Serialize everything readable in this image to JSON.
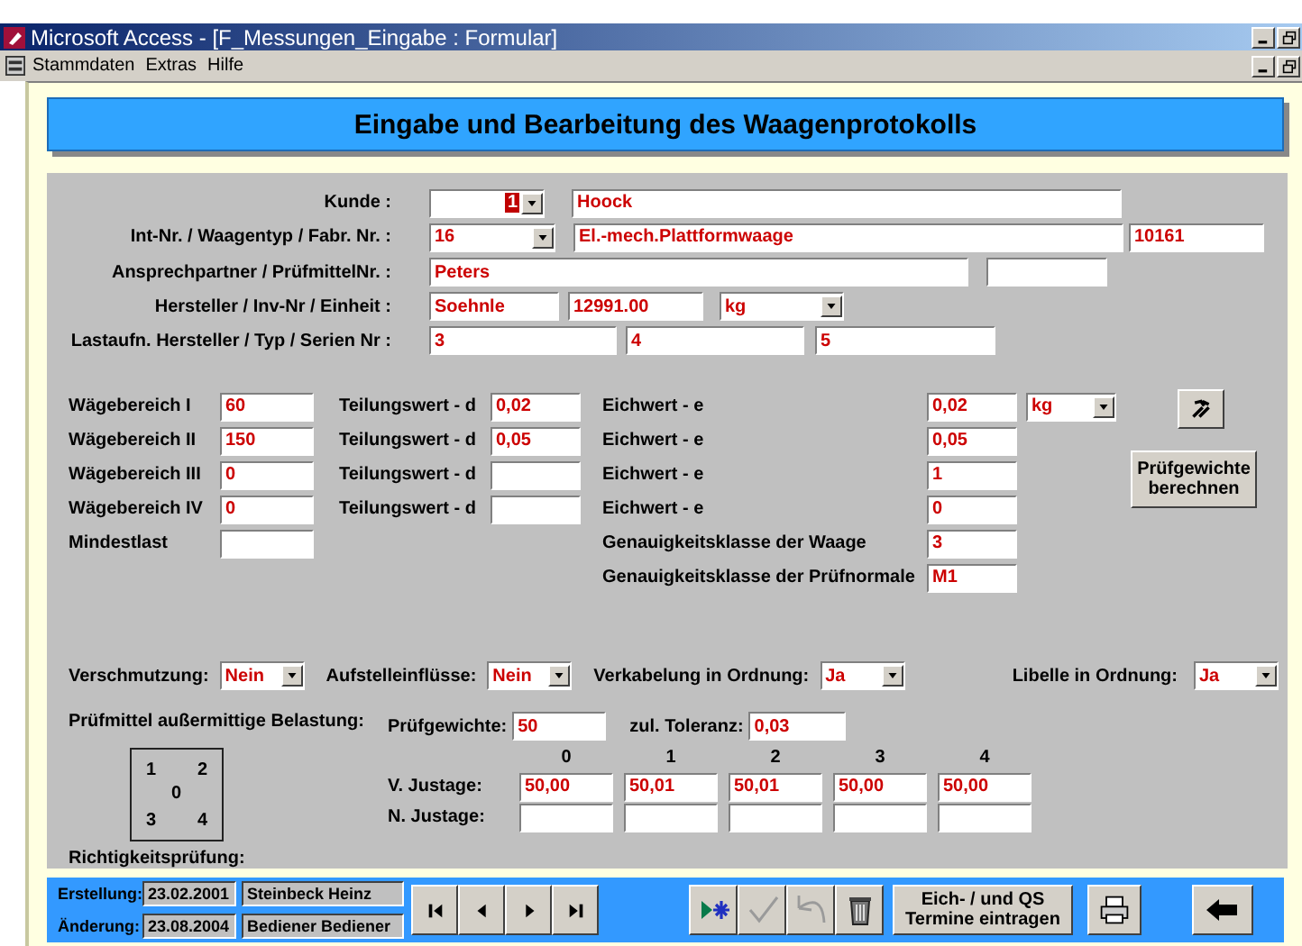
{
  "window": {
    "title": "Microsoft Access - [F_Messungen_Eingabe : Formular]",
    "menu": [
      "Stammdaten",
      "Extras",
      "Hilfe"
    ]
  },
  "header": "Eingabe und Bearbeitung des Waagenprotokolls",
  "customer_rows": [
    {
      "label": "Kunde :",
      "fields": [
        {
          "kind": "combo",
          "value": "1",
          "text_selected": true
        },
        {
          "kind": "text",
          "value": "Hoock"
        }
      ]
    },
    {
      "label": "Int-Nr. / Waagentyp / Fabr. Nr. :",
      "fields": [
        {
          "kind": "combo",
          "value": "16"
        },
        {
          "kind": "text",
          "value": "El.-mech.Plattformwaage"
        },
        {
          "kind": "text",
          "value": "10161"
        }
      ]
    },
    {
      "label": "Ansprechpartner / PrüfmittelNr. :",
      "fields": [
        {
          "kind": "text",
          "value": "Peters"
        },
        {
          "kind": "text"
        }
      ]
    },
    {
      "label": "Hersteller / Inv-Nr / Einheit :",
      "fields": [
        {
          "kind": "text",
          "value": "Soehnle"
        },
        {
          "kind": "text",
          "value": "12991.00"
        },
        {
          "kind": "combo",
          "value": "kg"
        }
      ]
    },
    {
      "label": "Lastaufn. Hersteller / Typ / Serien Nr :",
      "fields": [
        {
          "kind": "text",
          "value": "3"
        },
        {
          "kind": "text",
          "value": "4"
        },
        {
          "kind": "text",
          "value": "5"
        }
      ]
    }
  ],
  "ranges": [
    {
      "label": "Wägebereich I",
      "value": "60",
      "d_label": "Teilungswert - d",
      "d_value": "0,02",
      "e_label": "Eichwert - e",
      "e_value": "0,02",
      "unit": "kg"
    },
    {
      "label": "Wägebereich II",
      "value": "150",
      "d_label": "Teilungswert - d",
      "d_value": "0,05",
      "e_label": "Eichwert - e",
      "e_value": "0,05"
    },
    {
      "label": "Wägebereich III",
      "value": "0",
      "d_label": "Teilungswert - d",
      "e_label": "Eichwert - e",
      "e_value": "1"
    },
    {
      "label": "Wägebereich IV",
      "value": "0",
      "d_label": "Teilungswert - d",
      "e_label": "Eichwert - e",
      "e_value": "0"
    }
  ],
  "min_load": {
    "label": "Mindestlast"
  },
  "classes": [
    {
      "label": "Genauigkeitsklasse der Waage",
      "value": "3"
    },
    {
      "label": "Genauigkeitsklasse der Prüfnormale",
      "value": "M1"
    }
  ],
  "calc_button": "Prüfgewichte berechnen",
  "conditions": [
    {
      "label": "Verschmutzung:",
      "value": "Nein"
    },
    {
      "label": "Aufstelleinflüsse:",
      "value": "Nein"
    },
    {
      "label": "Verkabelung in Ordnung:",
      "value": "Ja"
    },
    {
      "label": "Libelle in Ordnung:",
      "value": "Ja"
    }
  ],
  "eccentric": {
    "label": "Prüfmittel außermittige Belastung:",
    "weights_label": "Prüfgewichte:",
    "weights": "50",
    "tolerance_label": "zul. Toleranz:",
    "tolerance": "0,03",
    "positions": [
      "1",
      "2",
      "0",
      "3",
      "4"
    ],
    "columns": [
      "0",
      "1",
      "2",
      "3",
      "4"
    ],
    "rows": [
      {
        "label": "V. Justage:",
        "values": [
          "50,00",
          "50,01",
          "50,01",
          "50,00",
          "50,00"
        ]
      },
      {
        "label": "N. Justage:"
      }
    ]
  },
  "accuracy_label": "Richtigkeitsprüfung:",
  "footer": {
    "created_label": "Erstellung:",
    "created_date": "23.02.2001",
    "created_by": "Steinbeck Heinz",
    "changed_label": "Änderung:",
    "changed_date": "23.08.2004",
    "changed_by": "Bediener Bediener",
    "nav": [
      {
        "kind": "first",
        "disabled": false
      },
      {
        "kind": "prev",
        "disabled": false
      },
      {
        "kind": "next",
        "disabled": false
      },
      {
        "kind": "last",
        "disabled": false
      }
    ],
    "actions": [
      {
        "kind": "new",
        "disabled": false
      },
      {
        "kind": "save",
        "disabled": true
      },
      {
        "kind": "undo",
        "disabled": true
      },
      {
        "kind": "delete",
        "disabled": false
      }
    ],
    "schedule_button": "Eich- / und QS Termine eintragen"
  }
}
